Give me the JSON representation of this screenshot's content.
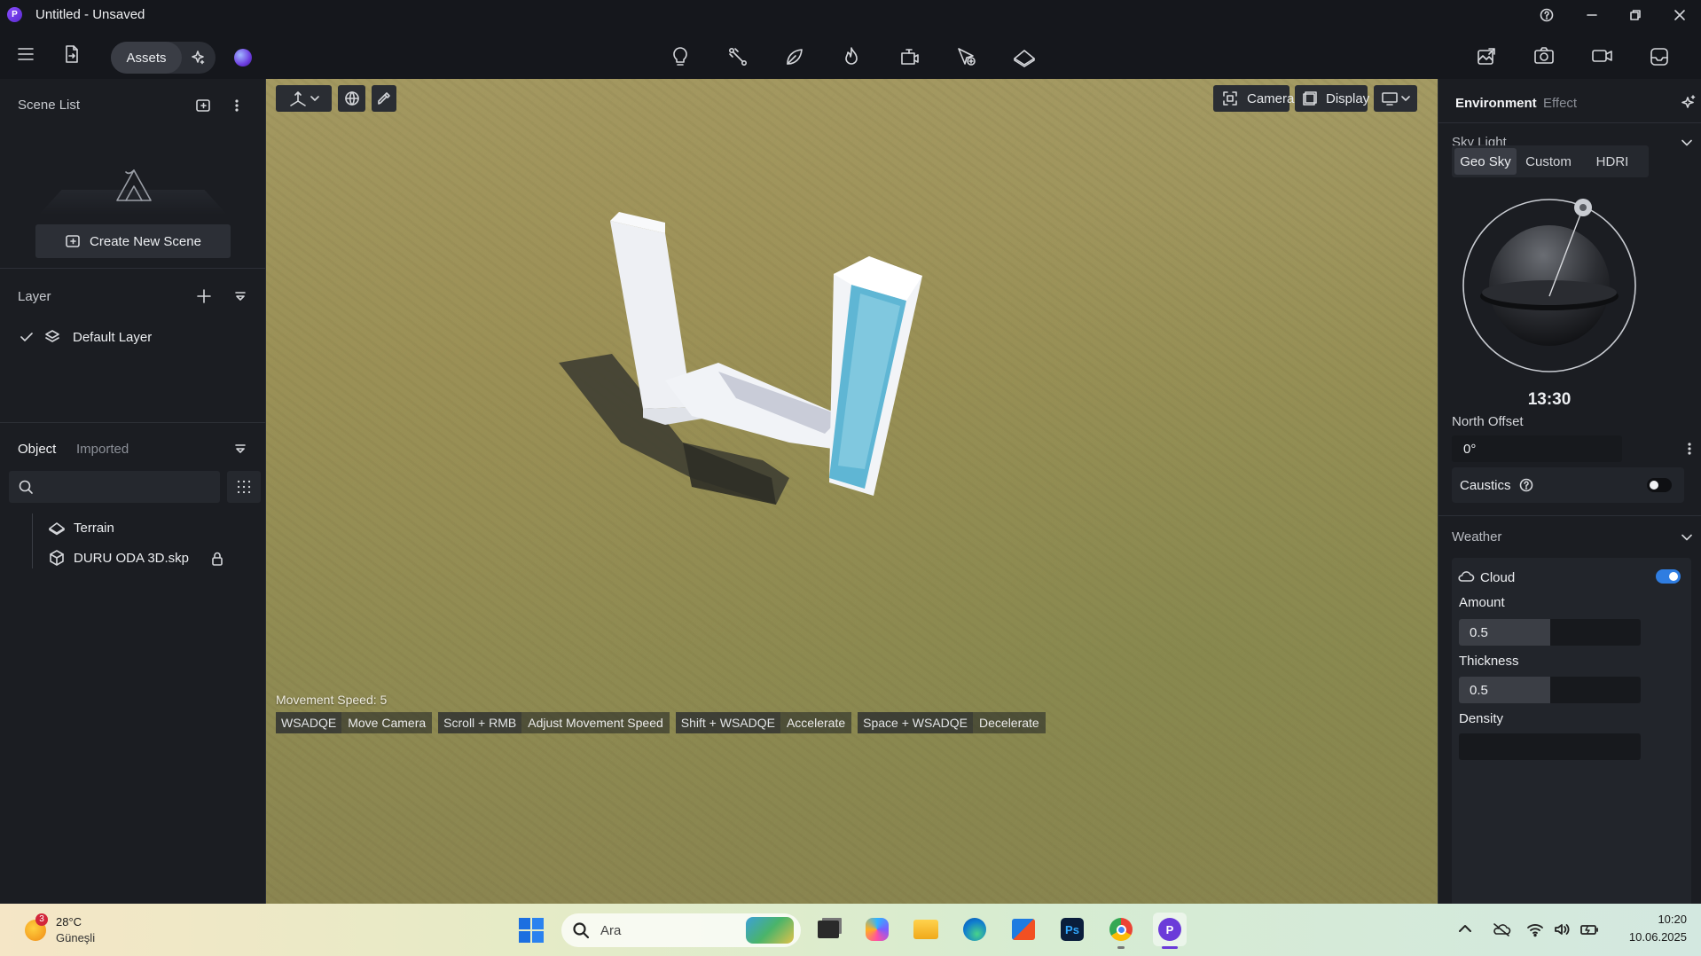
{
  "window": {
    "title": "Untitled - Unsaved"
  },
  "toolbar": {
    "assets_label": "Assets"
  },
  "scene_list": {
    "title": "Scene List",
    "create_button": "Create New Scene"
  },
  "layer": {
    "title": "Layer",
    "items": [
      {
        "label": "Default Layer",
        "checked": true
      }
    ]
  },
  "objects": {
    "tabs": [
      "Object",
      "Imported"
    ],
    "search_placeholder": "",
    "items": [
      {
        "label": "Terrain",
        "icon": "terrain-icon"
      },
      {
        "label": "DURU ODA 3D.skp",
        "icon": "cube-icon",
        "locked": true
      }
    ]
  },
  "viewport": {
    "camera_label": "Camera",
    "display_label": "Display",
    "movement_speed": "Movement Speed: 5",
    "hints": [
      {
        "key": "WSADQE",
        "action": "Move Camera"
      },
      {
        "key": "Scroll + RMB",
        "action": "Adjust Movement Speed"
      },
      {
        "key": "Shift + WSADQE",
        "action": "Accelerate"
      },
      {
        "key": "Space + WSADQE",
        "action": "Decelerate"
      }
    ]
  },
  "right": {
    "tabs": [
      "Environment",
      "Effect"
    ],
    "sky_light": {
      "title": "Sky Light",
      "modes": [
        "Geo Sky",
        "Custom",
        "HDRI"
      ],
      "active_mode": "Geo Sky",
      "time": "13:30"
    },
    "north_offset": {
      "label": "North Offset",
      "value": "0°"
    },
    "caustics": {
      "label": "Caustics",
      "enabled": false
    },
    "weather": {
      "title": "Weather"
    },
    "cloud": {
      "label": "Cloud",
      "enabled": true,
      "amount": {
        "label": "Amount",
        "value": "0.5",
        "fraction": 0.5
      },
      "thickness": {
        "label": "Thickness",
        "value": "0.5",
        "fraction": 0.5
      },
      "density": {
        "label": "Density"
      }
    }
  },
  "taskbar": {
    "weather_temp": "28°C",
    "weather_desc": "Güneşli",
    "weather_badge": "3",
    "search_label": "Ara",
    "time": "10:20",
    "date": "10.06.2025"
  },
  "colors": {
    "accent": "#2f7de1",
    "taskbar_active": "#6b3bd9"
  }
}
